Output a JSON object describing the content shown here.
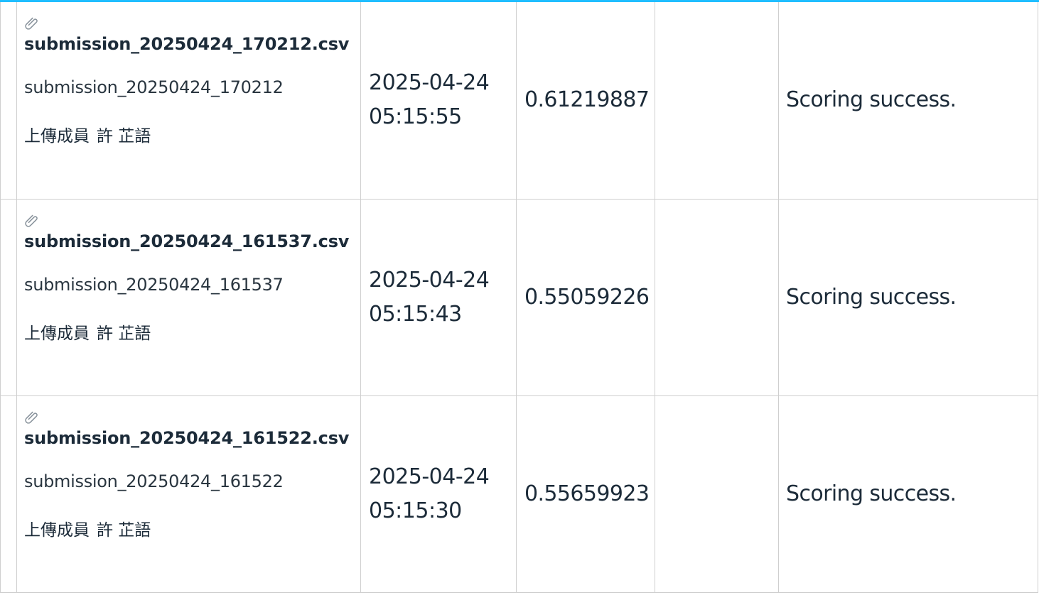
{
  "accent_color": "#20beff",
  "uploader_label": "上傳成員",
  "attachment_icon": "paperclip-icon",
  "submissions": [
    {
      "file_name": "submission_20250424_170212.csv",
      "description": "submission_20250424_170212",
      "uploader": "許 芷語",
      "date": "2025-04-24",
      "time": "05:15:55",
      "score": "0.61219887",
      "private_score": "",
      "status": "Scoring success."
    },
    {
      "file_name": "submission_20250424_161537.csv",
      "description": "submission_20250424_161537",
      "uploader": "許 芷語",
      "date": "2025-04-24",
      "time": "05:15:43",
      "score": "0.55059226",
      "private_score": "",
      "status": "Scoring success."
    },
    {
      "file_name": "submission_20250424_161522.csv",
      "description": "submission_20250424_161522",
      "uploader": "許 芷語",
      "date": "2025-04-24",
      "time": "05:15:30",
      "score": "0.55659923",
      "private_score": "",
      "status": "Scoring success."
    }
  ]
}
